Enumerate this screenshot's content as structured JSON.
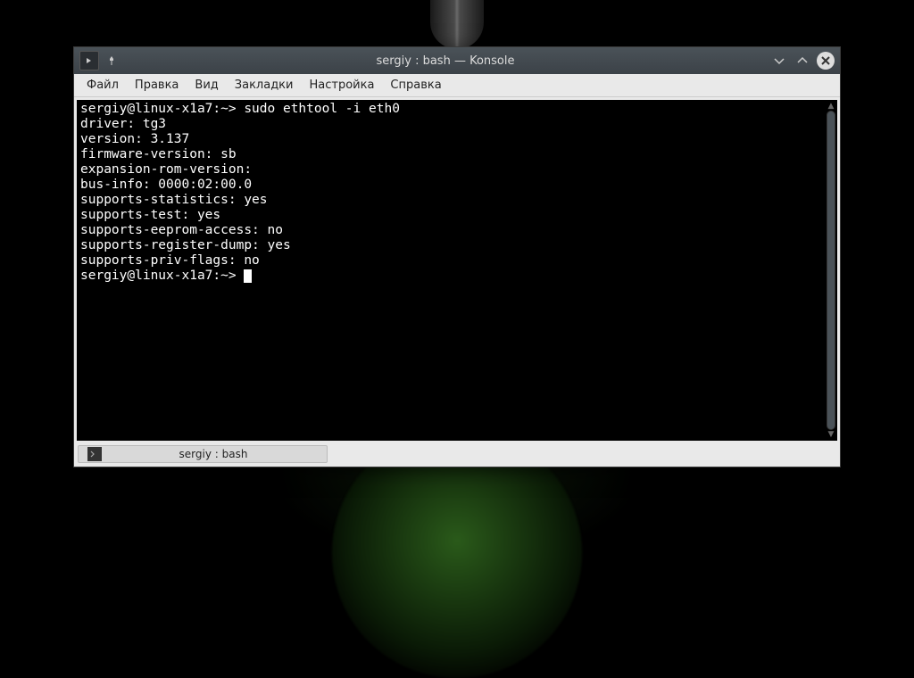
{
  "window": {
    "title": "sergiy : bash — Konsole"
  },
  "menu": {
    "file": "Файл",
    "edit": "Правка",
    "view": "Вид",
    "bookmarks": "Закладки",
    "settings": "Настройка",
    "help": "Справка"
  },
  "terminal": {
    "lines": [
      "sergiy@linux-x1a7:~> sudo ethtool -i eth0",
      "driver: tg3",
      "version: 3.137",
      "firmware-version: sb",
      "expansion-rom-version:",
      "bus-info: 0000:02:00.0",
      "supports-statistics: yes",
      "supports-test: yes",
      "supports-eeprom-access: no",
      "supports-register-dump: yes",
      "supports-priv-flags: no"
    ],
    "prompt": "sergiy@linux-x1a7:~> "
  },
  "tab": {
    "label": "sergiy : bash"
  }
}
